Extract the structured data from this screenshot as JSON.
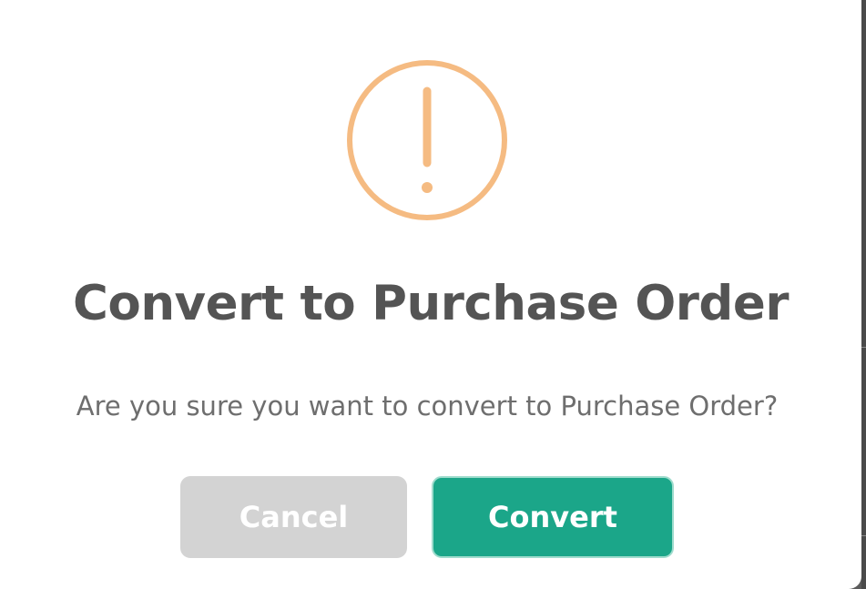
{
  "dialog": {
    "icon": "exclamation-circle-icon",
    "icon_color": "#f5bb82",
    "title": "Convert to Purchase Order",
    "message": "Are you sure you want to convert to Purchase Order?",
    "cancel_label": "Cancel",
    "confirm_label": "Convert",
    "cancel_color": "#d3d3d3",
    "confirm_color": "#1ba689"
  }
}
